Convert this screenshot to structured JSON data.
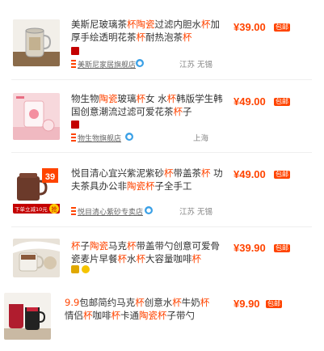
{
  "items": [
    {
      "title_segments": [
        {
          "t": "美斯尼玻璃茶"
        },
        {
          "t": "杯",
          "hl": true
        },
        {
          "t": "陶瓷",
          "hl": true
        },
        {
          "t": "过滤内胆水"
        },
        {
          "t": "杯",
          "hl": true
        },
        {
          "t": "加厚"
        },
        {
          "t": "手绘透明花茶"
        },
        {
          "t": "杯",
          "hl": true
        },
        {
          "t": "耐热泡茶"
        },
        {
          "t": "杯",
          "hl": true
        }
      ],
      "price": "¥39.00",
      "badge": "包邮",
      "shop": "美斯尼家居旗舰店",
      "location": "江苏 无锡"
    },
    {
      "title_segments": [
        {
          "t": "物生物"
        },
        {
          "t": "陶瓷",
          "hl": true
        },
        {
          "t": "玻璃"
        },
        {
          "t": "杯",
          "hl": true
        },
        {
          "t": "女 水"
        },
        {
          "t": "杯",
          "hl": true
        },
        {
          "t": "韩版学生韩"
        },
        {
          "t": "国创意潮流过滤可爱花茶"
        },
        {
          "t": "杯",
          "hl": true
        },
        {
          "t": "子"
        }
      ],
      "price": "¥49.00",
      "badge": "包邮",
      "shop": "物生物旗舰店",
      "location": "上海"
    },
    {
      "title_segments": [
        {
          "t": "悦目清心宜兴紫泥紫砂"
        },
        {
          "t": "杯",
          "hl": true
        },
        {
          "t": "带盖茶"
        },
        {
          "t": "杯",
          "hl": true
        },
        {
          "t": " 功"
        },
        {
          "t": "夫茶具办公非"
        },
        {
          "t": "陶瓷",
          "hl": true
        },
        {
          "t": "杯",
          "hl": true
        },
        {
          "t": "子全手工"
        }
      ],
      "price": "¥49.00",
      "badge": "包邮",
      "shop": "悦目清心紫砂专卖店",
      "location": "江苏 无锡"
    },
    {
      "title_segments": [
        {
          "t": "杯",
          "hl": true
        },
        {
          "t": "子"
        },
        {
          "t": "陶瓷",
          "hl": true
        },
        {
          "t": "马克"
        },
        {
          "t": "杯",
          "hl": true
        },
        {
          "t": "带盖带勺创意可爱骨瓷"
        },
        {
          "t": "麦片早餐"
        },
        {
          "t": "杯",
          "hl": true
        },
        {
          "t": "水"
        },
        {
          "t": "杯",
          "hl": true
        },
        {
          "t": "大容量咖啡"
        },
        {
          "t": "杯",
          "hl": true
        }
      ],
      "price": "¥39.90",
      "badge": "包邮",
      "shop": "",
      "location": ""
    },
    {
      "title_segments": [
        {
          "t": "9.9",
          "hl": true
        },
        {
          "t": "包邮简约马克"
        },
        {
          "t": "杯",
          "hl": true
        },
        {
          "t": "创意水"
        },
        {
          "t": "杯",
          "hl": true
        },
        {
          "t": "牛奶"
        },
        {
          "t": "杯",
          "hl": true
        },
        {
          "t": "情"
        },
        {
          "t": "侣"
        },
        {
          "t": "杯",
          "hl": true
        },
        {
          "t": "咖啡"
        },
        {
          "t": "杯",
          "hl": true
        },
        {
          "t": "卡通"
        },
        {
          "t": "陶瓷",
          "hl": true
        },
        {
          "t": "杯",
          "hl": true
        },
        {
          "t": "子带勺"
        }
      ],
      "price": "¥9.90",
      "badge": "包邮",
      "shop": "",
      "location": ""
    }
  ],
  "promo": {
    "price_tag": "39",
    "strip": "下单立减10元",
    "grab": "抢"
  },
  "colors": {
    "accent": "#ff4400",
    "tmall": "#c40000",
    "wangwang": "#3aa0e6"
  }
}
